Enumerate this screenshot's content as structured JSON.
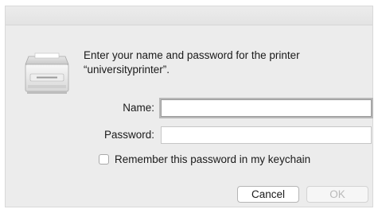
{
  "dialog": {
    "prompt_line1": "Enter your name and password for the printer",
    "prompt_line2": "“universityprinter”.",
    "name_label": "Name:",
    "name_value": "",
    "password_label": "Password:",
    "password_value": "",
    "remember_label": "Remember this password in my keychain",
    "remember_checked": false,
    "cancel_label": "Cancel",
    "ok_label": "OK",
    "ok_enabled": false,
    "icon": "printer-icon"
  }
}
